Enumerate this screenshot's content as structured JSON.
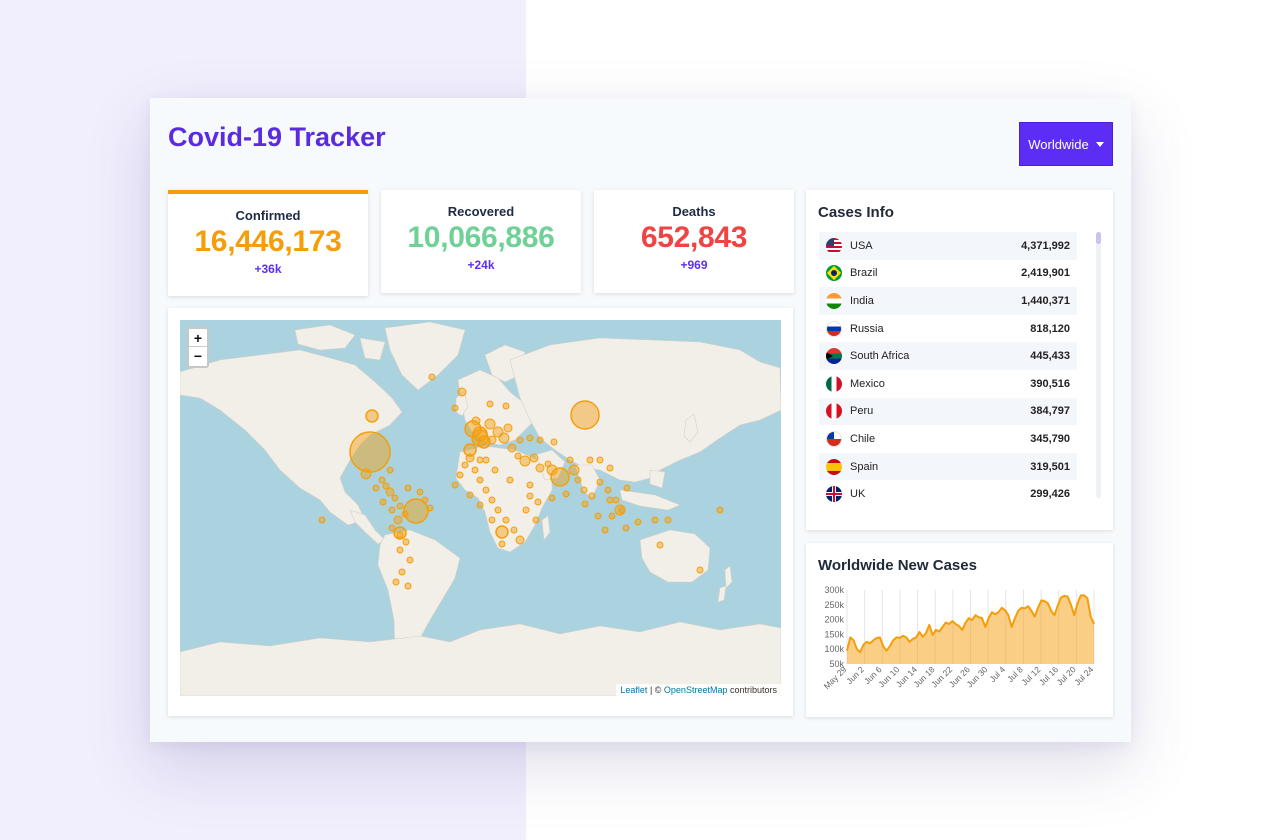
{
  "app": {
    "title": "Covid-19 Tracker"
  },
  "country_select": {
    "selected": "Worldwide"
  },
  "stats": [
    {
      "label": "Confirmed",
      "value": "16,446,173",
      "delta": "+36k",
      "color": "#f59e0b",
      "active": true
    },
    {
      "label": "Recovered",
      "value": "10,066,886",
      "delta": "+24k",
      "color": "#6fd196",
      "active": false
    },
    {
      "label": "Deaths",
      "value": "652,843",
      "delta": "+969",
      "color": "#ef4444",
      "active": false
    }
  ],
  "map": {
    "attribution_leaflet": "Leaflet",
    "attribution_sep": " | © ",
    "attribution_osm": "OpenStreetMap",
    "attribution_tail": " contributors",
    "circle_color": "#f59e0b"
  },
  "cases_info": {
    "title": "Cases Info",
    "rows": [
      {
        "country": "USA",
        "cases": "4,371,992",
        "flag": "usa-flag-icon"
      },
      {
        "country": "Brazil",
        "cases": "2,419,901",
        "flag": "brazil-flag-icon"
      },
      {
        "country": "India",
        "cases": "1,440,371",
        "flag": "india-flag-icon"
      },
      {
        "country": "Russia",
        "cases": "818,120",
        "flag": "russia-flag-icon"
      },
      {
        "country": "South Africa",
        "cases": "445,433",
        "flag": "south-africa-flag-icon"
      },
      {
        "country": "Mexico",
        "cases": "390,516",
        "flag": "mexico-flag-icon"
      },
      {
        "country": "Peru",
        "cases": "384,797",
        "flag": "peru-flag-icon"
      },
      {
        "country": "Chile",
        "cases": "345,790",
        "flag": "chile-flag-icon"
      },
      {
        "country": "Spain",
        "cases": "319,501",
        "flag": "spain-flag-icon"
      },
      {
        "country": "UK",
        "cases": "299,426",
        "flag": "uk-flag-icon"
      }
    ]
  },
  "new_cases": {
    "title": "Worldwide New Cases"
  },
  "chart_data": {
    "type": "area",
    "title": "Worldwide New Cases",
    "xlabel": "",
    "ylabel": "",
    "ylim": [
      50000,
      300000
    ],
    "yticks": [
      50000,
      100000,
      150000,
      200000,
      250000,
      300000
    ],
    "ytick_labels": [
      "50k",
      "100k",
      "150k",
      "200k",
      "250k",
      "300k"
    ],
    "xtick_labels": [
      "May 29",
      "Jun 2",
      "Jun 6",
      "Jun 10",
      "Jun 14",
      "Jun 18",
      "Jun 22",
      "Jun 26",
      "Jun 30",
      "Jul 4",
      "Jul 8",
      "Jul 12",
      "Jul 16",
      "Jul 20",
      "Jul 24"
    ],
    "color": "#f59e0b",
    "grid": "vertical",
    "values": [
      95000,
      140000,
      130000,
      100000,
      90000,
      115000,
      125000,
      120000,
      130000,
      138000,
      140000,
      110000,
      95000,
      110000,
      130000,
      140000,
      138000,
      145000,
      140000,
      125000,
      135000,
      140000,
      158000,
      142000,
      155000,
      182000,
      148000,
      165000,
      160000,
      175000,
      190000,
      185000,
      195000,
      185000,
      178000,
      165000,
      190000,
      205000,
      198000,
      215000,
      208000,
      205000,
      175000,
      205000,
      225000,
      218000,
      225000,
      240000,
      232000,
      215000,
      175000,
      205000,
      230000,
      240000,
      238000,
      245000,
      230000,
      210000,
      240000,
      265000,
      262000,
      255000,
      230000,
      215000,
      248000,
      275000,
      280000,
      278000,
      250000,
      215000,
      255000,
      282000,
      282000,
      272000,
      210000,
      185000
    ]
  }
}
